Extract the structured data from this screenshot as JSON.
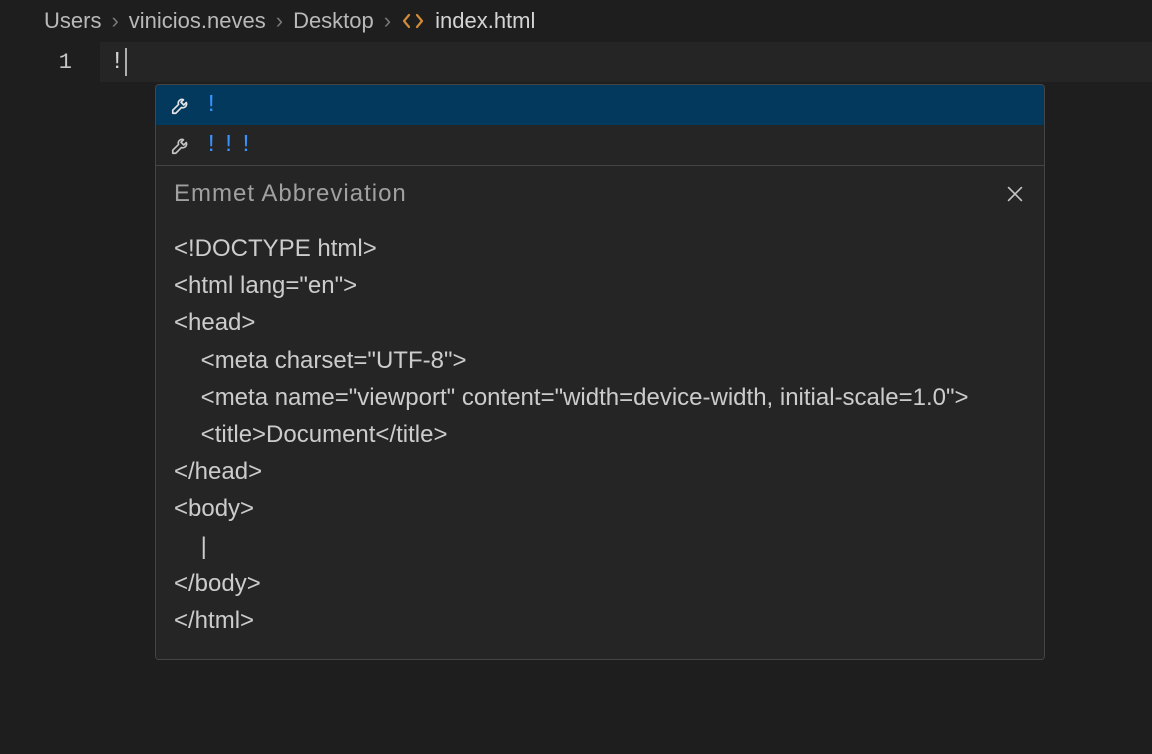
{
  "breadcrumb": {
    "segments": [
      "Users",
      "vinicios.neves",
      "Desktop"
    ],
    "separator": "›",
    "file": "index.html"
  },
  "editor": {
    "line_number": "1",
    "typed": "!"
  },
  "suggest": {
    "items": [
      {
        "label": "!",
        "selected": true
      },
      {
        "label": "!!!",
        "selected": false
      }
    ],
    "doc_title": "Emmet Abbreviation",
    "doc_body": "<!DOCTYPE html>\n<html lang=\"en\">\n<head>\n    <meta charset=\"UTF-8\">\n    <meta name=\"viewport\" content=\"width=device-width, initial-scale=1.0\">\n    <title>Document</title>\n</head>\n<body>\n    |\n</body>\n</html>"
  }
}
